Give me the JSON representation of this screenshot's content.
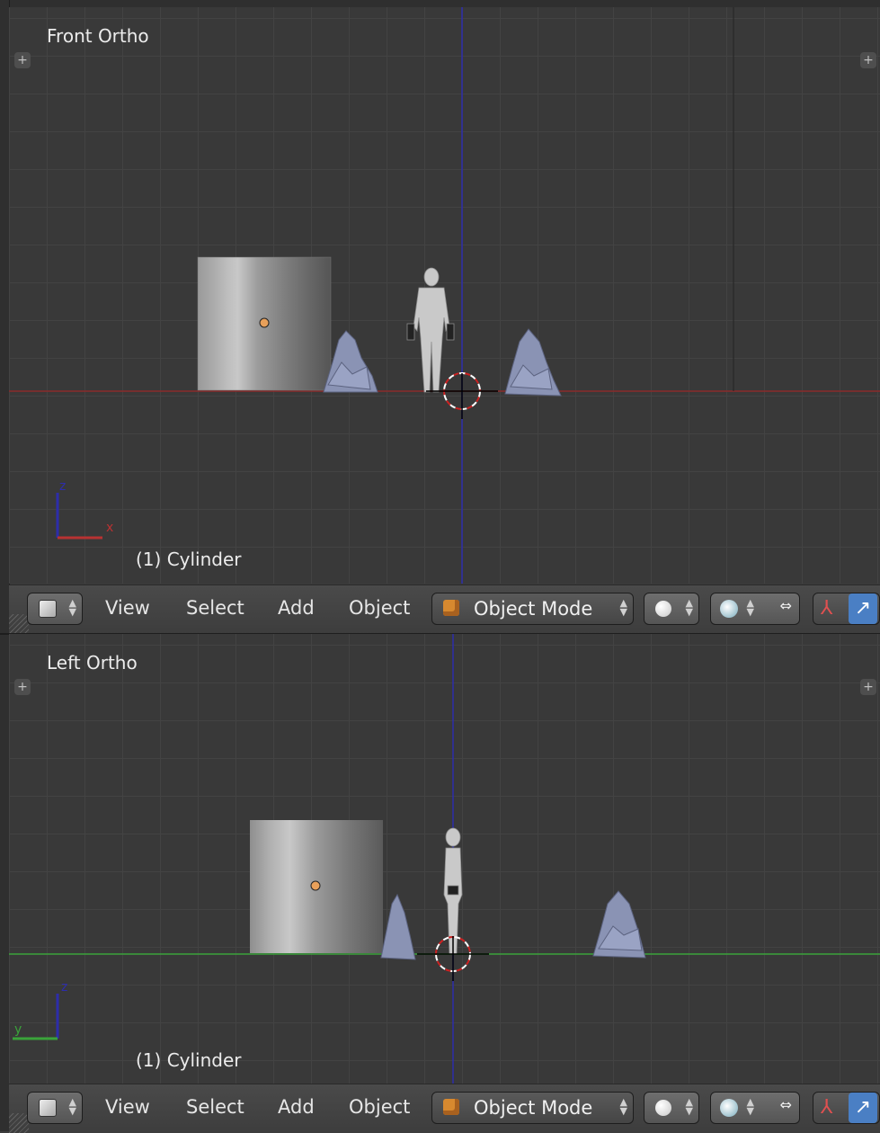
{
  "views": [
    {
      "view_label": "Front Ortho",
      "object_label": "(1) Cylinder",
      "axis_labels": {
        "vertical": "z",
        "horizontal": "x"
      }
    },
    {
      "view_label": "Left Ortho",
      "object_label": "(1) Cylinder",
      "axis_labels": {
        "vertical": "z",
        "horizontal": "y"
      }
    }
  ],
  "toolbar": {
    "menus": [
      "View",
      "Select",
      "Add",
      "Object"
    ],
    "mode": "Object Mode"
  },
  "colors": {
    "x_axis": "#b83232",
    "y_axis": "#3aa33a",
    "z_axis": "#2d2daa",
    "viewport_bg": "#393939",
    "object_origin": "#e8a05a"
  }
}
